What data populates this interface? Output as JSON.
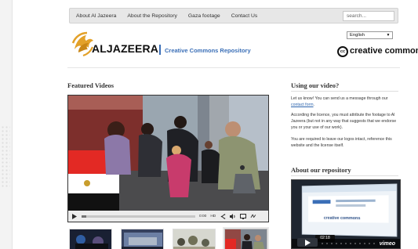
{
  "nav": {
    "items": [
      {
        "label": "About Al Jazeera"
      },
      {
        "label": "About the Repository"
      },
      {
        "label": "Gaza footage"
      },
      {
        "label": "Contact Us"
      }
    ],
    "search_placeholder": "search..."
  },
  "header": {
    "aljazeera_text": "ALJAZEERA",
    "repository_title": "Creative Commons Repository",
    "language_value": "English",
    "cc_logo_text": "creative commons"
  },
  "featured_videos": {
    "title": "Featured Videos",
    "controls": {
      "time": "0:00",
      "hd": "HD"
    },
    "thumbnails": [
      {
        "name": "thumbnail-1"
      },
      {
        "name": "thumbnail-2"
      },
      {
        "name": "thumbnail-3"
      },
      {
        "name": "thumbnail-4"
      }
    ]
  },
  "right_column": {
    "using_title": "Using our video?",
    "para1_prefix": "Let us know! You can send us a message through our",
    "contact_form": "contact form",
    "para1_suffix": ".",
    "para2": "According the licence, you must attribute the footage to Al Jazeera (but not in any way that suggests that we endorse you or your use of our work).",
    "para3": "You are required to leave our logos intact, reference this website and the license itself.",
    "about_title": "About our repository",
    "repo_video": {
      "time": "02:18",
      "vimeo": "vimeo",
      "preview_text": "creative commons"
    }
  },
  "colors": {
    "brand_blue": "#3b6fb7",
    "link_blue": "#2c64ad",
    "aj_gold": "#e3a129"
  }
}
